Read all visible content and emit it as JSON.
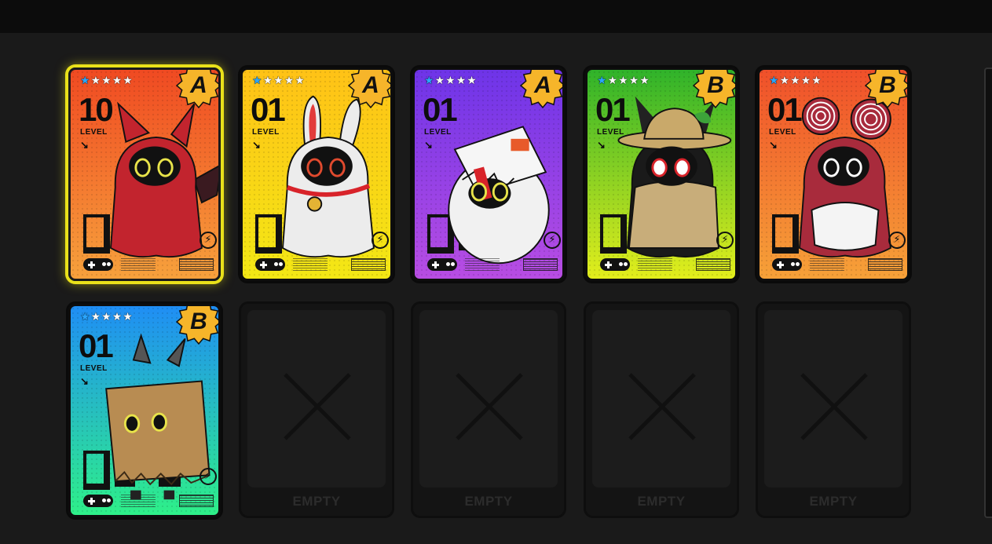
{
  "cards": [
    {
      "level": "10",
      "level_label": "LEVEL",
      "grade": "A",
      "stars_lit": 1,
      "selected": true,
      "bg_top": "#f04a22",
      "bg_bottom": "#f7a13c",
      "character": "red-devil-bangboo",
      "body": "#c2242e",
      "eye": "#e8e34a"
    },
    {
      "level": "01",
      "level_label": "LEVEL",
      "grade": "A",
      "stars_lit": 1,
      "selected": false,
      "bg_top": "#ffc216",
      "bg_bottom": "#f3e815",
      "character": "white-rabbit-bangboo",
      "body": "#ececec",
      "eye": "#e04a2e"
    },
    {
      "level": "01",
      "level_label": "LEVEL",
      "grade": "A",
      "stars_lit": 1,
      "selected": false,
      "bg_top": "#6e34e8",
      "bg_bottom": "#b84de3",
      "character": "box-sale-bangboo",
      "body": "#f1f1f1",
      "eye": "#e8e34a"
    },
    {
      "level": "01",
      "level_label": "LEVEL",
      "grade": "B",
      "stars_lit": 1,
      "selected": false,
      "bg_top": "#2fb32a",
      "bg_bottom": "#e3ee1c",
      "character": "explorer-bangboo",
      "body": "#c8ad7a",
      "eye": "#d8232a"
    },
    {
      "level": "01",
      "level_label": "LEVEL",
      "grade": "B",
      "stars_lit": 1,
      "selected": false,
      "bg_top": "#f0502a",
      "bg_bottom": "#f6a138",
      "character": "swirl-bear-bangboo",
      "body": "#a82b3c",
      "eye": "#ffffff"
    },
    {
      "level": "01",
      "level_label": "LEVEL",
      "grade": "B",
      "stars_lit": 1,
      "selected": false,
      "bg_top": "#1f8ef5",
      "bg_bottom": "#2ef089",
      "character": "paper-bag-bangboo",
      "body": "#b88c52",
      "eye": "#e8e34a"
    }
  ],
  "empty_slots": [
    {
      "label": "EMPTY"
    },
    {
      "label": "EMPTY"
    },
    {
      "label": "EMPTY"
    },
    {
      "label": "EMPTY"
    }
  ],
  "colors": {
    "background": "#1a1a1a",
    "selected_outline": "#e9e11a",
    "grade_badge": "#f6b52a",
    "star_lit": "#2aa6ff"
  }
}
